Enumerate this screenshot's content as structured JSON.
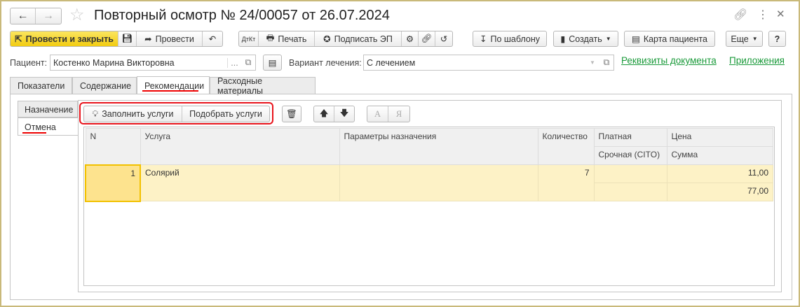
{
  "window": {
    "title": "Повторный осмотр № 24/00057 от 26.07.2024"
  },
  "toolbar": {
    "post_close": "Провести и закрыть",
    "post": "Провести",
    "print": "Печать",
    "sign": "Подписать ЭП",
    "template": "По шаблону",
    "create": "Создать",
    "card": "Карта пациента",
    "more": "Еще",
    "help": "?"
  },
  "form": {
    "patient_label": "Пациент:",
    "patient_value": "Костенко Марина Викторовна",
    "patient_select": "...",
    "variant_label": "Вариант лечения:",
    "variant_value": "С лечением",
    "link_requisites": "Реквизиты документа",
    "link_attachments": "Приложения"
  },
  "tabs": [
    "Показатели",
    "Содержание",
    "Рекомендации",
    "Расходные материалы"
  ],
  "side_tabs": [
    "Назначение",
    "Отмена"
  ],
  "inner_toolbar": {
    "fill": "Заполнить услуги",
    "pick": "Подобрать услуги",
    "sort_a": "А",
    "sort_z": "Я"
  },
  "table": {
    "headers": {
      "n": "N",
      "service": "Услуга",
      "params": "Параметры назначения",
      "qty": "Количество",
      "paid": "Платная",
      "cito": "Срочная (CITO)",
      "price": "Цена",
      "sum": "Сумма"
    },
    "rows": [
      {
        "n": "1",
        "service": "Солярий",
        "params": "",
        "qty": "7",
        "paid": "",
        "cito": "",
        "price": "11,00",
        "sum": "77,00"
      }
    ]
  }
}
